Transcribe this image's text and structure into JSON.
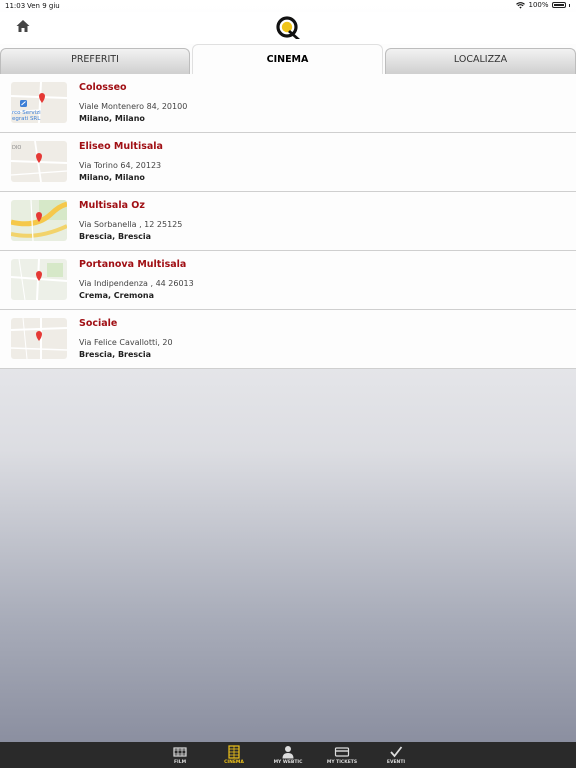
{
  "status_bar": {
    "time": "11:03",
    "date": "Ven 9 giu",
    "battery": "100%"
  },
  "header": {
    "home_icon": "home-icon",
    "logo_icon": "q-logo-icon"
  },
  "tabs": [
    {
      "label": "PREFERITI",
      "active": false
    },
    {
      "label": "CINEMA",
      "active": true
    },
    {
      "label": "LOCALIZZA",
      "active": false
    }
  ],
  "cinemas": [
    {
      "name": "Colosseo",
      "address": "Viale Montenero 84, 20100",
      "city": "Milano, Milano",
      "map_label_1": "rco Servizi",
      "map_label_2": "egrati SRL"
    },
    {
      "name": "Eliseo Multisala",
      "address": "Via Torino 64, 20123",
      "city": "Milano, Milano",
      "map_label_1": "DIO"
    },
    {
      "name": "Multisala Oz",
      "address": "Via Sorbanella , 12  25125",
      "city": "Brescia, Brescia"
    },
    {
      "name": "Portanova Multisala",
      "address": "Via Indipendenza , 44  26013",
      "city": "Crema, Cremona"
    },
    {
      "name": "Sociale",
      "address": "Via Felice Cavallotti, 20",
      "city": "Brescia, Brescia"
    }
  ],
  "bottom_nav": [
    {
      "label": "FILM",
      "icon": "film-icon",
      "active": false
    },
    {
      "label": "CINEMA",
      "icon": "cinema-icon",
      "active": true
    },
    {
      "label": "MY WEBTIC",
      "icon": "user-icon",
      "active": false
    },
    {
      "label": "MY TICKETS",
      "icon": "ticket-icon",
      "active": false
    },
    {
      "label": "EVENTI",
      "icon": "check-icon",
      "active": false
    }
  ],
  "colors": {
    "accent_red": "#a00f14",
    "active_yellow": "#f0c419",
    "bar_dark": "#2a2a2a"
  }
}
